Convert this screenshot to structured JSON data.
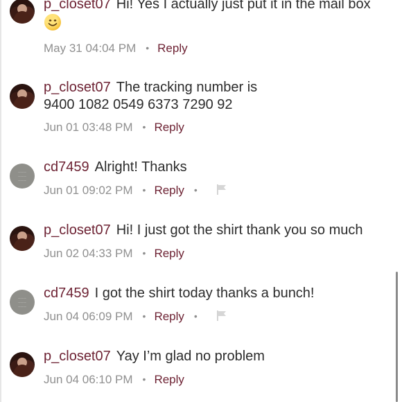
{
  "comments": [
    {
      "username": "p_closet07",
      "message": "Hi! Yes I actually just put it in the mail box",
      "emoji": "smiling-face",
      "timestamp": "May 31 04:04 PM",
      "reply_label": "Reply",
      "avatar": "profile-photo"
    },
    {
      "username": "p_closet07",
      "message": "The tracking number is",
      "message_line2": "9400 1082 0549 6373 7290 92",
      "timestamp": "Jun 01 03:48 PM",
      "reply_label": "Reply",
      "avatar": "profile-photo"
    },
    {
      "username": "cd7459",
      "message": "Alright! Thanks",
      "timestamp": "Jun 01 09:02 PM",
      "reply_label": "Reply",
      "avatar": "default-avatar",
      "has_flag": true
    },
    {
      "username": "p_closet07",
      "message": "Hi! I just got the shirt thank you so much",
      "timestamp": "Jun 02 04:33 PM",
      "reply_label": "Reply",
      "avatar": "profile-photo"
    },
    {
      "username": "cd7459",
      "message": "I got the shirt today thanks a bunch!",
      "timestamp": "Jun 04 06:09 PM",
      "reply_label": "Reply",
      "avatar": "default-avatar",
      "has_flag": true
    },
    {
      "username": "p_closet07",
      "message": "Yay I’m glad no problem",
      "timestamp": "Jun 04 06:10 PM",
      "reply_label": "Reply",
      "avatar": "profile-photo"
    }
  ],
  "icons": {
    "dot": "•",
    "flag": "flag-icon",
    "emoji": "smiling-face-emoji"
  },
  "colors": {
    "username": "#6d2233",
    "reply": "#6d2233",
    "text": "#2b2b2b",
    "meta": "#8f8f8f"
  }
}
